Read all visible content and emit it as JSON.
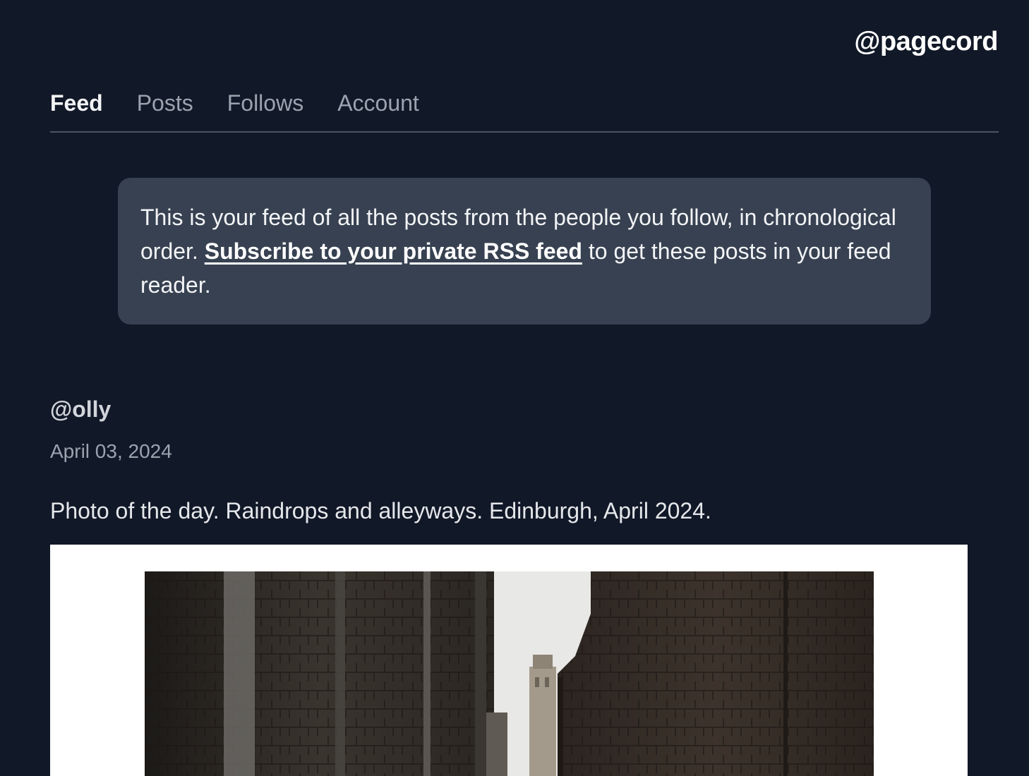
{
  "header": {
    "brand": "@pagecord"
  },
  "nav": {
    "tabs": [
      {
        "label": "Feed",
        "active": true
      },
      {
        "label": "Posts",
        "active": false
      },
      {
        "label": "Follows",
        "active": false
      },
      {
        "label": "Account",
        "active": false
      }
    ]
  },
  "notice": {
    "text_before": "This is your feed of all the posts from the people you follow, in chronological order. ",
    "link_text": "Subscribe to your private RSS feed",
    "text_after": " to get these posts in your feed reader."
  },
  "post": {
    "author": "@olly",
    "date": "April 03, 2024",
    "text": "Photo of the day. Raindrops and alleyways. Edinburgh, April 2024.",
    "image_alt": "Narrow stone alleyway in Edinburgh"
  },
  "colors": {
    "background": "#111827",
    "notice_bg": "#374151",
    "tab_inactive": "#9ca3af",
    "tab_active": "#f3f4f6"
  }
}
